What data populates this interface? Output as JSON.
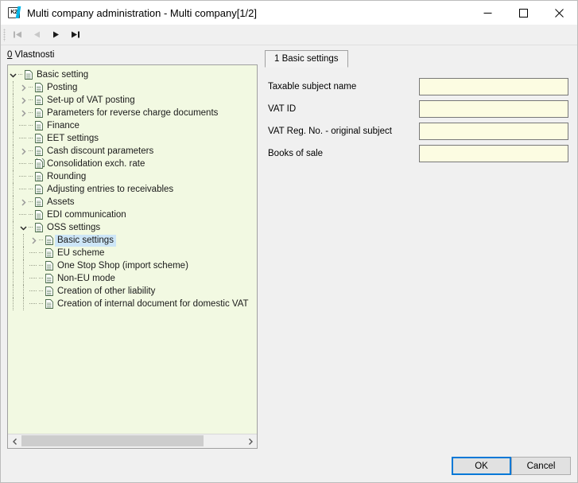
{
  "window": {
    "title": "Multi company administration - Multi company[1/2]",
    "app_icon": "k2-logo-icon",
    "controls": {
      "minimize": "minimize-icon",
      "maximize": "maximize-icon",
      "close": "close-icon"
    }
  },
  "navbar": {
    "buttons": [
      {
        "name": "first-record",
        "icon": "skip-to-start-icon",
        "enabled": false
      },
      {
        "name": "previous-record",
        "icon": "step-back-icon",
        "enabled": false
      },
      {
        "name": "next-record",
        "icon": "play-forward-icon",
        "enabled": true
      },
      {
        "name": "last-record",
        "icon": "skip-to-end-icon",
        "enabled": true
      }
    ]
  },
  "left_panel": {
    "label_accel": "0",
    "label_text": " Vlastnosti",
    "tree": [
      {
        "label": "Basic setting",
        "level": 0,
        "state": "expanded",
        "icon": "document-icon",
        "selected": false
      },
      {
        "label": "Posting",
        "level": 1,
        "state": "collapsed",
        "icon": "document-icon",
        "selected": false
      },
      {
        "label": "Set-up of VAT posting",
        "level": 1,
        "state": "collapsed",
        "icon": "document-icon",
        "selected": false
      },
      {
        "label": "Parameters for reverse charge documents",
        "level": 1,
        "state": "collapsed",
        "icon": "document-icon",
        "selected": false
      },
      {
        "label": "Finance",
        "level": 1,
        "state": "leaf",
        "icon": "document-icon",
        "selected": false
      },
      {
        "label": "EET settings",
        "level": 1,
        "state": "leaf",
        "icon": "document-icon",
        "selected": false
      },
      {
        "label": "Cash discount parameters",
        "level": 1,
        "state": "collapsed",
        "icon": "document-icon",
        "selected": false
      },
      {
        "label": "Consolidation exch. rate",
        "level": 1,
        "state": "leaf",
        "icon": "documents-stack-icon",
        "selected": false
      },
      {
        "label": "Rounding",
        "level": 1,
        "state": "leaf",
        "icon": "document-icon",
        "selected": false
      },
      {
        "label": "Adjusting entries to receivables",
        "level": 1,
        "state": "leaf",
        "icon": "document-icon",
        "selected": false
      },
      {
        "label": "Assets",
        "level": 1,
        "state": "collapsed",
        "icon": "document-icon",
        "selected": false
      },
      {
        "label": "EDI communication",
        "level": 1,
        "state": "leaf",
        "icon": "document-icon",
        "selected": false
      },
      {
        "label": "OSS settings",
        "level": 1,
        "state": "expanded",
        "icon": "document-icon",
        "selected": false
      },
      {
        "label": "Basic settings",
        "level": 2,
        "state": "collapsed",
        "icon": "document-icon",
        "selected": true
      },
      {
        "label": "EU scheme",
        "level": 2,
        "state": "leaf",
        "icon": "document-icon",
        "selected": false
      },
      {
        "label": "One Stop Shop (import scheme)",
        "level": 2,
        "state": "leaf",
        "icon": "document-icon",
        "selected": false
      },
      {
        "label": "Non-EU mode",
        "level": 2,
        "state": "leaf",
        "icon": "document-icon",
        "selected": false
      },
      {
        "label": "Creation of other liability",
        "level": 2,
        "state": "leaf",
        "icon": "document-icon",
        "selected": false
      },
      {
        "label": "Creation of internal document for domestic VAT",
        "level": 2,
        "state": "leaf",
        "icon": "document-icon",
        "selected": false
      }
    ],
    "hscrollbar": {
      "left_arrow": "chevron-left-icon",
      "right_arrow": "chevron-right-icon"
    }
  },
  "right_panel": {
    "tabs": [
      {
        "label": "1 Basic settings",
        "active": true
      }
    ],
    "fields": [
      {
        "label": "Taxable subject name",
        "value": "",
        "placeholder": ""
      },
      {
        "label": "VAT ID",
        "value": "",
        "placeholder": ""
      },
      {
        "label": "VAT Reg. No. - original subject",
        "value": "",
        "placeholder": ""
      },
      {
        "label": "Books of sale",
        "value": "",
        "placeholder": ""
      }
    ]
  },
  "footer": {
    "ok_label": "OK",
    "cancel_label": "Cancel"
  },
  "colors": {
    "tree_background": "#f2f9e2",
    "selection": "#cde6f7",
    "input_background": "#fcfce2",
    "focus_border": "#0078d7",
    "accent": "#00b6e8"
  }
}
